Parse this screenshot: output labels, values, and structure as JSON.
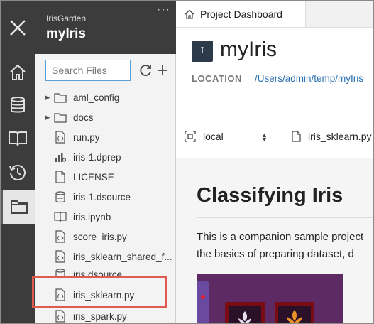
{
  "workspace": {
    "name": "IrisGarden",
    "project": "myIris",
    "menu_dots": "···"
  },
  "rail": {
    "items": [
      "home",
      "data",
      "notebooks",
      "history",
      "files"
    ],
    "active": "files"
  },
  "file_panel": {
    "search_placeholder": "Search Files",
    "items": [
      {
        "label": "aml_config",
        "type": "folder",
        "collapsed": true
      },
      {
        "label": "docs",
        "type": "folder",
        "collapsed": true
      },
      {
        "label": "run.py",
        "type": "script"
      },
      {
        "label": "iris-1.dprep",
        "type": "dprep"
      },
      {
        "label": "LICENSE",
        "type": "file"
      },
      {
        "label": "iris-1.dsource",
        "type": "dsource"
      },
      {
        "label": "iris.ipynb",
        "type": "notebook"
      },
      {
        "label": "score_iris.py",
        "type": "script"
      },
      {
        "label": "iris_sklearn_shared_f...",
        "type": "script"
      },
      {
        "label": "iris.dsource",
        "type": "dsource"
      },
      {
        "label": "iris_sklearn.py",
        "type": "script",
        "highlighted": true
      },
      {
        "label": "iris_spark.py",
        "type": "script"
      }
    ]
  },
  "main": {
    "tab_label": "Project Dashboard",
    "badge_letter": "I",
    "project_title": "myIris",
    "location_label": "LOCATION",
    "location_path": "/Users/admin/temp/myIris",
    "run_target": "local",
    "run_script": "iris_sklearn.py",
    "heading": "Classifying Iris",
    "paragraph_line1": "This is a companion sample project",
    "paragraph_line2": "the basics of preparing dataset, d"
  },
  "colors": {
    "rail_bg": "#3c3c3c",
    "panel_bg": "#f3f3f3",
    "highlight": "#e05a4e",
    "link": "#2a6fb0",
    "search_border": "#5aa0d8"
  }
}
